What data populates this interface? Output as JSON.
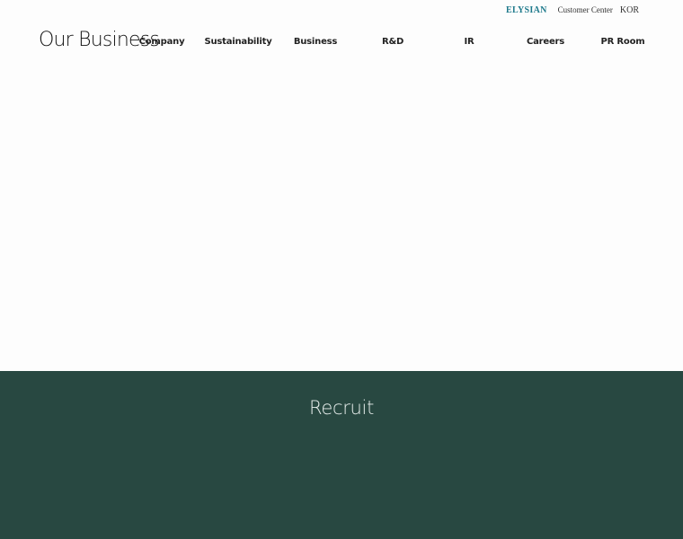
{
  "utility": {
    "brand": "ELYSIAN",
    "customer_center": "Customer Center",
    "language": "KOR"
  },
  "page_title": "Our Business",
  "nav": {
    "company": "Company",
    "sustainability": "Sustainability",
    "business": "Business",
    "rnd": "R&D",
    "ir": "IR",
    "careers": "Careers",
    "pr_room": "PR Room"
  },
  "recruit": {
    "title": "Recruit"
  },
  "colors": {
    "brand": "#1f7a8c",
    "recruit_bg": "#284841",
    "recruit_text": "#e7eeec"
  }
}
